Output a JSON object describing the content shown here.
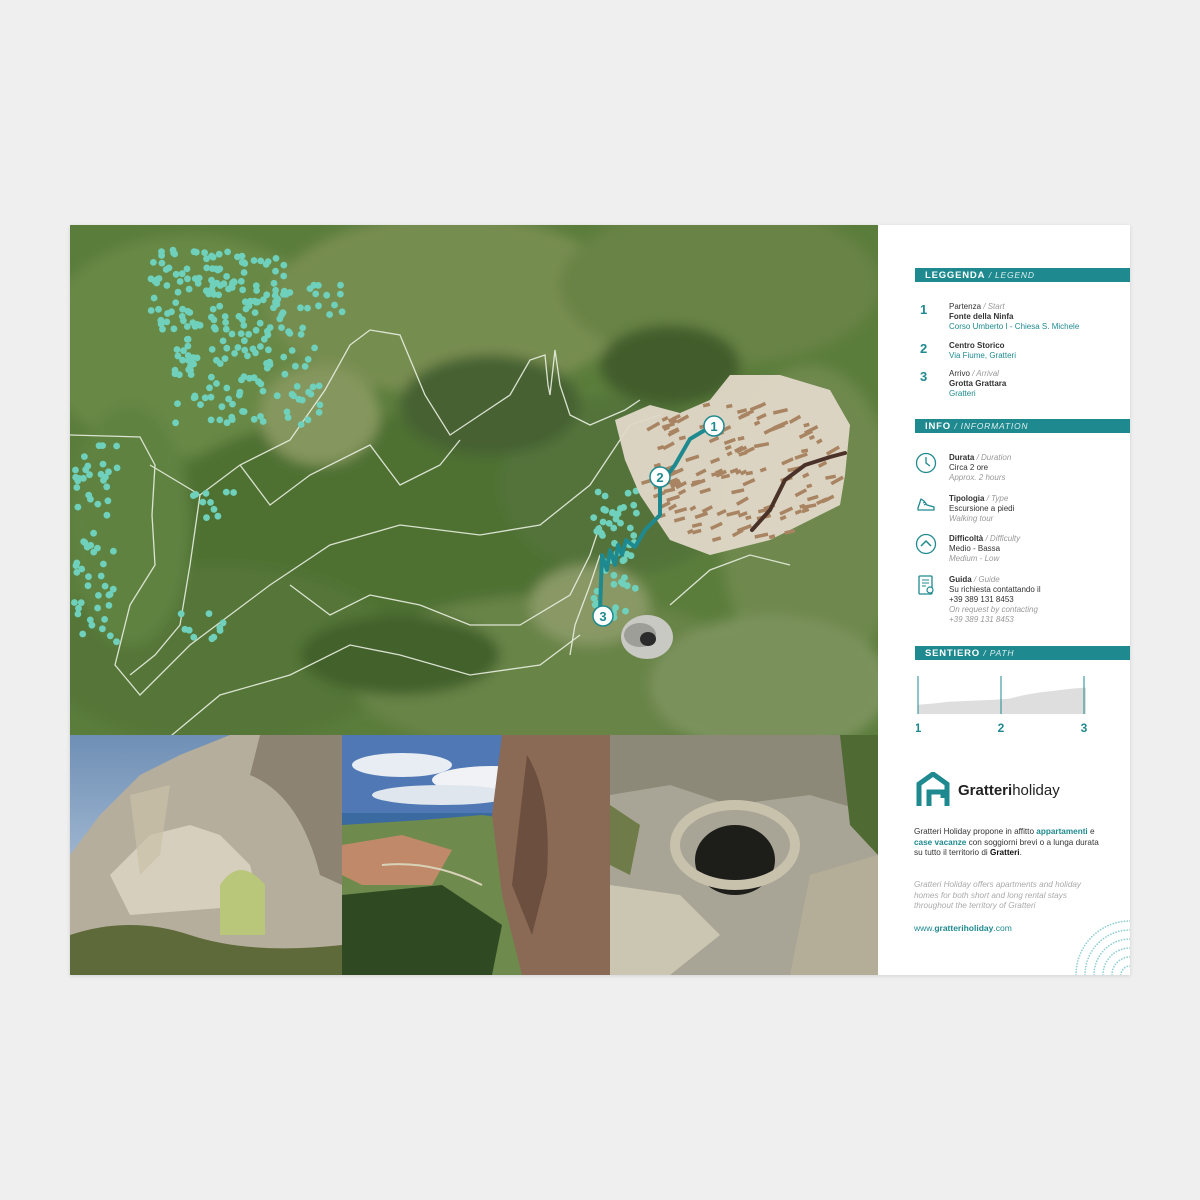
{
  "legend": {
    "header": "LEGGENDA",
    "header_en": "/ LEGEND",
    "items": [
      {
        "num": "1",
        "line1": "Partenza",
        "line1_en": "/ Start",
        "name": "Fonte della Ninfa",
        "place": "Corso Umberto I - Chiesa S. Michele"
      },
      {
        "num": "2",
        "line1": "",
        "line1_en": "",
        "name": "Centro Storico",
        "place": "Via Fiume, Gratteri"
      },
      {
        "num": "3",
        "line1": "Arrivo",
        "line1_en": "/ Arrival",
        "name": "Grotta Grattara",
        "place": "Gratteri"
      }
    ]
  },
  "info": {
    "header": "INFO",
    "header_en": "/ INFORMATION",
    "items": [
      {
        "icon": "clock-icon",
        "label": "Durata",
        "label_en": "/ Duration",
        "value": "Circa 2 ore",
        "value_en": "Approx. 2 hours"
      },
      {
        "icon": "shoe-icon",
        "label": "Tipologia",
        "label_en": "/ Type",
        "value": "Escursione a piedi",
        "value_en": "Walking tour"
      },
      {
        "icon": "chevron-up-icon",
        "label": "Difficoltà",
        "label_en": "/ Difficulty",
        "value": "Medio - Bassa",
        "value_en": "Medium - Low"
      },
      {
        "icon": "guide-book-icon",
        "label": "Guida",
        "label_en": "/ Guide",
        "value": "Su richiesta contattando il",
        "value2": "+39 389 131 8453",
        "value_en": "On request by contacting",
        "value_en2": "+39 389 131 8453"
      }
    ]
  },
  "path": {
    "header": "SENTIERO",
    "header_en": "/ PATH",
    "points": [
      "1",
      "2",
      "3"
    ],
    "elevation_profile": [
      0.3,
      0.34,
      0.4,
      0.42,
      0.44,
      0.46,
      0.5,
      0.62,
      0.7,
      0.76,
      0.82,
      0.86
    ]
  },
  "brand": {
    "name_bold": "Gratteri",
    "name_light": "holiday",
    "desc_parts": [
      "Gratteri Holiday propone in affitto ",
      "appartamenti",
      " e ",
      "case vacanze",
      " con soggiorni brevi o a lunga durata su tutto il territorio di ",
      "Gratteri",
      "."
    ],
    "desc_en": "Gratteri Holiday offers apartments and holiday homes for both short and long rental stays throughout the territory of Gratteri",
    "url_plain": "www.",
    "url_bold": "gratteriholiday",
    "url_tail": ".com"
  },
  "map": {
    "markers": [
      "1",
      "2",
      "3"
    ]
  },
  "colors": {
    "accent": "#1e8a8f",
    "dots": "#6fd0bb",
    "town": "#a88462",
    "road": "#4a3228"
  }
}
